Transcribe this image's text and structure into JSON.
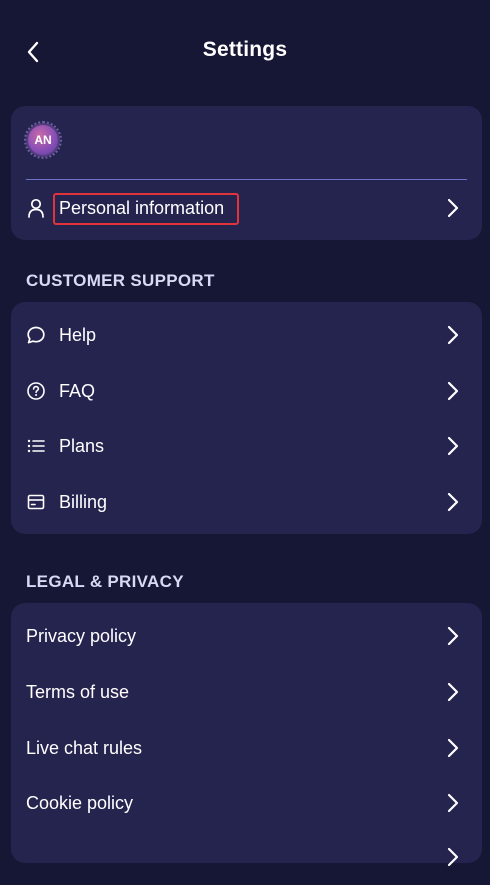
{
  "header": {
    "title": "Settings",
    "back_icon": "chevron-left-icon"
  },
  "profile": {
    "avatar_initials": "AN",
    "personal_info_label": "Personal information",
    "personal_info_icon": "user-icon"
  },
  "customer_support": {
    "title": "CUSTOMER SUPPORT",
    "items": [
      {
        "label": "Help",
        "icon": "chat-bubble-icon"
      },
      {
        "label": "FAQ",
        "icon": "question-circle-icon"
      },
      {
        "label": "Plans",
        "icon": "list-icon"
      },
      {
        "label": "Billing",
        "icon": "card-icon"
      }
    ]
  },
  "legal": {
    "title": "LEGAL & PRIVACY",
    "items": [
      {
        "label": "Privacy policy"
      },
      {
        "label": "Terms of use"
      },
      {
        "label": "Live chat rules"
      },
      {
        "label": "Cookie policy"
      }
    ]
  },
  "colors": {
    "background": "#161635",
    "card": "#25244f",
    "divider": "#6a73c7",
    "highlight": "#e0333c",
    "section_title": "#d8d9f3"
  }
}
